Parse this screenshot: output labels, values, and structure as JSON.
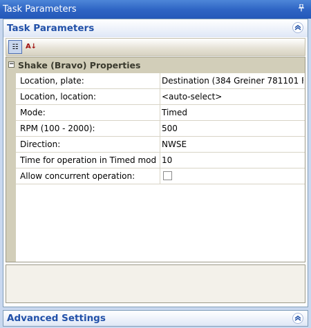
{
  "window": {
    "title": "Task Parameters",
    "pin_icon": "pin-icon"
  },
  "task_group": {
    "title": "Task Parameters",
    "collapse_icon": "double-chevron-up-icon"
  },
  "toolbar": {
    "categorized_icon": "categorized-view-icon",
    "alphabetical_icon": "sort-az-icon",
    "categorized_glyph": "☷",
    "alphabetical_glyph": "A↓"
  },
  "property_grid": {
    "category": "Shake (Bravo) Properties",
    "expander_glyph": "−",
    "rows": [
      {
        "key": "Location, plate:",
        "value": "Destination  (384 Greiner 781101 F"
      },
      {
        "key": "Location, location:",
        "value": "<auto-select>"
      },
      {
        "key": "Mode:",
        "value": "Timed"
      },
      {
        "key": "RPM (100 - 2000):",
        "value": "500"
      },
      {
        "key": "Direction:",
        "value": "NWSE"
      },
      {
        "key": "Time for operation in Timed mod",
        "value": "10"
      },
      {
        "key": "Allow concurrent operation:",
        "value": "",
        "checkbox": true,
        "checked": false
      }
    ]
  },
  "advanced_group": {
    "title": "Advanced Settings",
    "expand_icon": "double-chevron-up-icon"
  },
  "colors": {
    "titlebar": "#2d63c3",
    "group_header_text": "#2150a8",
    "category_bg": "#d2ceb9",
    "background": "#c9d8ef"
  }
}
